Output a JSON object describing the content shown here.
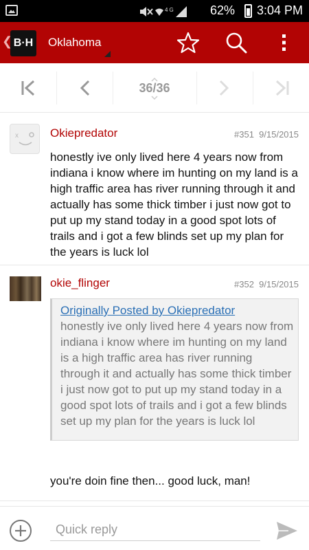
{
  "status_bar": {
    "battery": "62%",
    "time": "3:04 PM",
    "network": "4G",
    "icons": [
      "gallery-icon",
      "mute-icon",
      "wifi-icon",
      "signal-icon",
      "battery-icon"
    ]
  },
  "app_bar": {
    "logo_text": "B·H",
    "forum_title": "Oklahoma",
    "accent_color": "#b20404",
    "icons": [
      "back-chevron-icon",
      "star-icon",
      "search-icon",
      "overflow-menu-icon"
    ]
  },
  "pager": {
    "current_page": 36,
    "total_pages": 36,
    "counter_text": "36/36",
    "icons": [
      "first-page-icon",
      "prev-page-icon",
      "next-page-icon",
      "last-page-icon"
    ]
  },
  "posts": [
    {
      "username": "Okiepredator",
      "post_number": "#351",
      "date": "9/15/2015",
      "body": "honestly ive only lived here 4 years now from indiana i know where im hunting on my land is a high traffic area has river running through it and actually has some thick timber i just now got to put up my stand today in a good spot lots of trails and i got a few blinds set up my plan for the years is luck lol"
    },
    {
      "username": "okie_flinger",
      "post_number": "#352",
      "date": "9/15/2015",
      "quote": {
        "link": "Originally Posted by Okiepredator",
        "text": "honestly ive only lived here 4 years now from indiana i know where im hunting on my land is a high traffic area has river running through it and actually has some thick timber i just now got to put up my stand today in a good spot lots of trails and i got a few blinds set up my plan for the years is luck lol"
      },
      "body": "you're doin fine then... good luck, man!"
    }
  ],
  "reply_bar": {
    "placeholder": "Quick reply",
    "icons": [
      "add-circle-icon",
      "send-icon"
    ]
  }
}
